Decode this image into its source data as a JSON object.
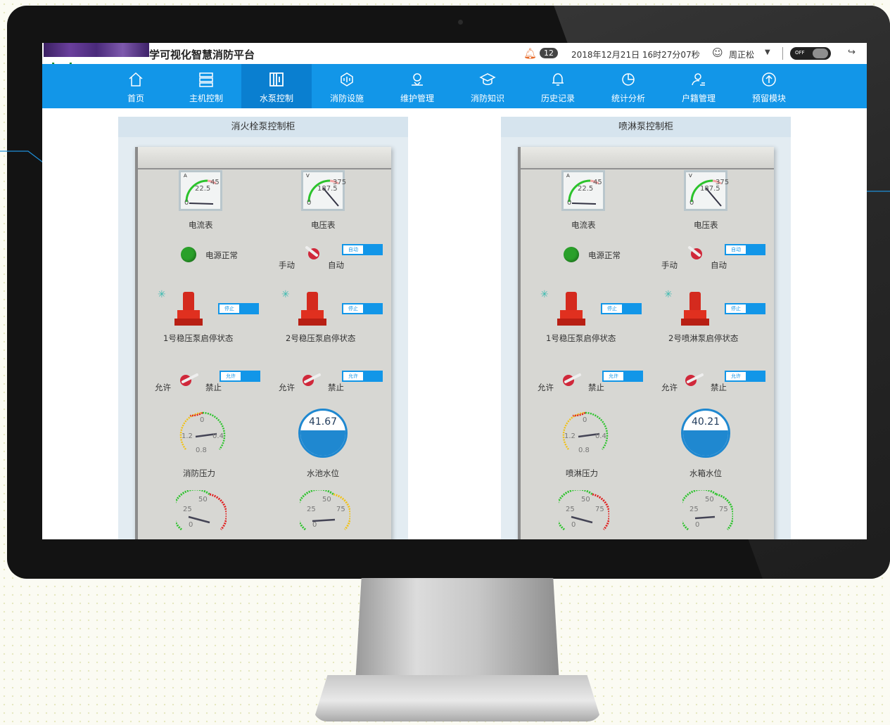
{
  "app": {
    "title_suffix": "学可视化智慧消防平台"
  },
  "header": {
    "alert_count": "12",
    "datetime": "2018年12月21日 16时27分07秒",
    "user": "周正松",
    "toggle_label": "OFF"
  },
  "nav": [
    {
      "label": "首页",
      "icon": "home-icon"
    },
    {
      "label": "主机控制",
      "icon": "server-icon"
    },
    {
      "label": "水泵控制",
      "icon": "pump-control-icon",
      "active": true
    },
    {
      "label": "消防设施",
      "icon": "facility-icon"
    },
    {
      "label": "维护管理",
      "icon": "location-icon"
    },
    {
      "label": "消防知识",
      "icon": "graduation-icon"
    },
    {
      "label": "历史记录",
      "icon": "bell-outline-icon"
    },
    {
      "label": "统计分析",
      "icon": "pie-icon"
    },
    {
      "label": "户籍管理",
      "icon": "user-edit-icon"
    },
    {
      "label": "预留模块",
      "icon": "upload-icon"
    }
  ],
  "panels": [
    {
      "title": "消火栓泵控制柜",
      "ammeter": {
        "label": "电流表",
        "unit": "A",
        "mid": "22.5",
        "max": "45",
        "zero": "0"
      },
      "voltmeter": {
        "label": "电压表",
        "unit": "V",
        "mid": "187.5",
        "max": "375",
        "zero": "0"
      },
      "power_label": "电源正常",
      "mode": {
        "left": "手动",
        "right": "自动",
        "switch": "自动"
      },
      "pump1": {
        "label": "1号稳压泵启停状态",
        "switch": "停止"
      },
      "pump2": {
        "label": "2号稳压泵启停状态",
        "switch": "停止"
      },
      "allow1": {
        "left": "允许",
        "right": "禁止",
        "switch": "允许"
      },
      "allow2": {
        "left": "允许",
        "right": "禁止",
        "switch": "允许"
      },
      "pressure": {
        "label": "消防压力",
        "top": "0",
        "left": "1.2",
        "right": "0.4",
        "bottom": "0.8"
      },
      "level": {
        "label": "水池水位",
        "value": "41.67"
      },
      "gauge_ticks": {
        "a": "50",
        "b": "25",
        "c": "75",
        "d": "0"
      }
    },
    {
      "title": "喷淋泵控制柜",
      "ammeter": {
        "label": "电流表",
        "unit": "A",
        "mid": "22.5",
        "max": "45",
        "zero": "0"
      },
      "voltmeter": {
        "label": "电压表",
        "unit": "V",
        "mid": "187.5",
        "max": "375",
        "zero": "0"
      },
      "power_label": "电源正常",
      "mode": {
        "left": "手动",
        "right": "自动",
        "switch": "自动"
      },
      "pump1": {
        "label": "1号稳压泵启停状态",
        "switch": "停止"
      },
      "pump2": {
        "label": "2号喷淋泵启停状态",
        "switch": "停止"
      },
      "allow1": {
        "left": "允许",
        "right": "禁止",
        "switch": "允许"
      },
      "allow2": {
        "left": "允许",
        "right": "禁止",
        "switch": "允许"
      },
      "pressure": {
        "label": "喷淋压力",
        "top": "0",
        "left": "1.2",
        "right": "0.4",
        "bottom": "0.8"
      },
      "level": {
        "label": "水箱水位",
        "value": "40.21"
      },
      "gauge_ticks": {
        "a": "50",
        "b": "25",
        "c": "75",
        "d": "0"
      }
    }
  ]
}
